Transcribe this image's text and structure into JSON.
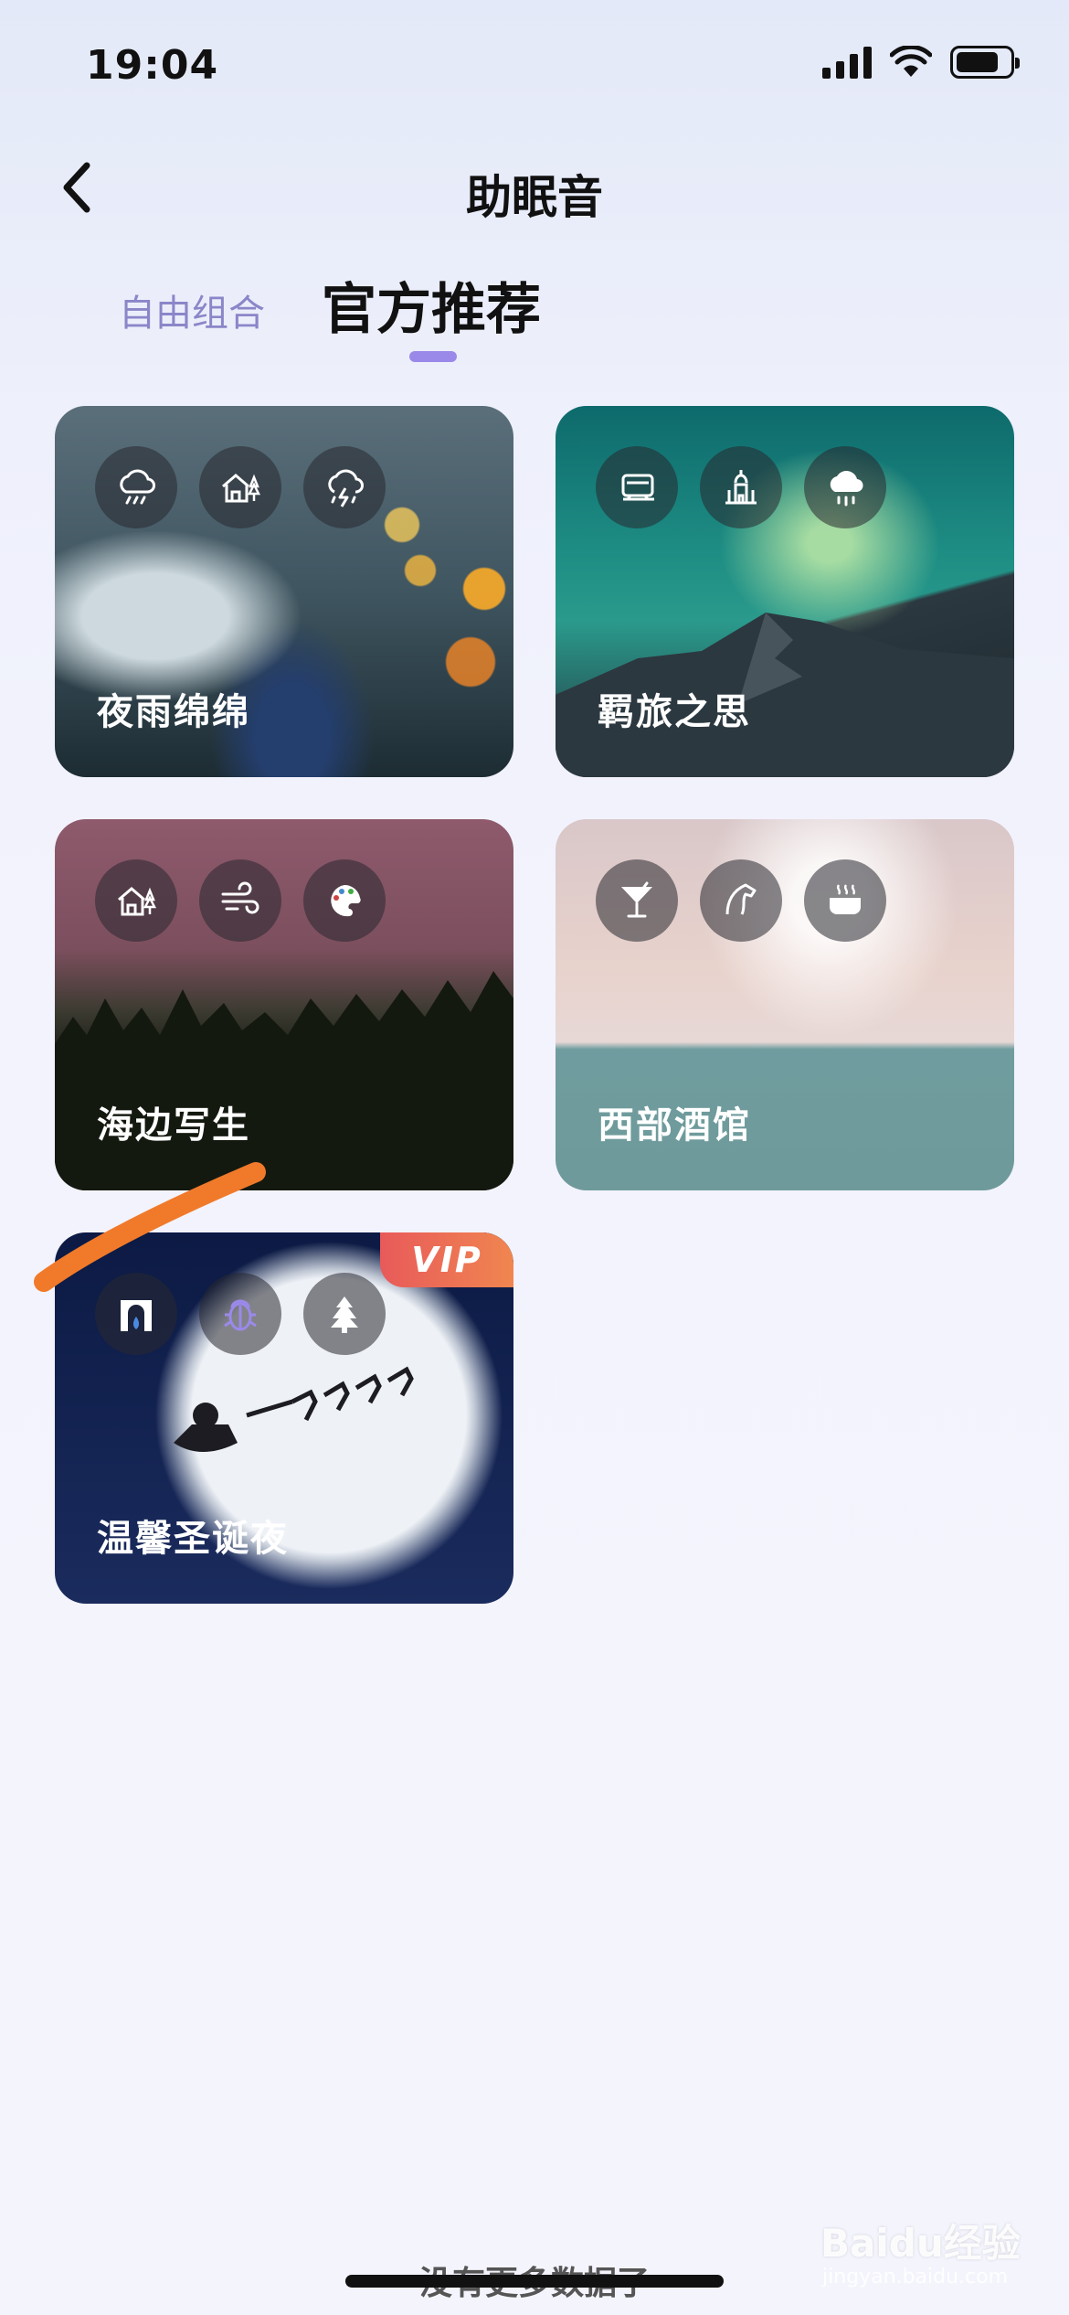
{
  "status_bar": {
    "time": "19:04",
    "battery_level": 0.8
  },
  "nav": {
    "title": "助眠音"
  },
  "tabs": [
    {
      "label": "自由组合",
      "active": false
    },
    {
      "label": "官方推荐",
      "active": true
    }
  ],
  "cards": [
    {
      "title": "夜雨绵绵",
      "icons": [
        "rain-cloud-icon",
        "cabin-icon",
        "thunderstorm-icon"
      ],
      "vip": false
    },
    {
      "title": "羁旅之思",
      "icons": [
        "train-icon",
        "castle-icon",
        "heavy-rain-icon"
      ],
      "vip": false
    },
    {
      "title": "海边写生",
      "icons": [
        "cabin-icon",
        "wind-icon",
        "palette-icon"
      ],
      "vip": false
    },
    {
      "title": "西部酒馆",
      "icons": [
        "cocktail-icon",
        "horse-icon",
        "pot-icon"
      ],
      "vip": false
    },
    {
      "title": "温馨圣诞夜",
      "icons": [
        "fireplace-icon",
        "bug-icon",
        "christmas-tree-icon"
      ],
      "vip": true,
      "vip_label": "VIP"
    }
  ],
  "footer": {
    "end_text": "没有更多数据了"
  },
  "watermark": {
    "brand": "Baidu经验",
    "url": "jingyan.baidu.com"
  },
  "colors": {
    "tab_active_indicator": "#9b89ea",
    "tab_inactive": "#8b86c9",
    "vip_badge": "#e85a5a",
    "annotation_stroke": "#f07a2a"
  }
}
